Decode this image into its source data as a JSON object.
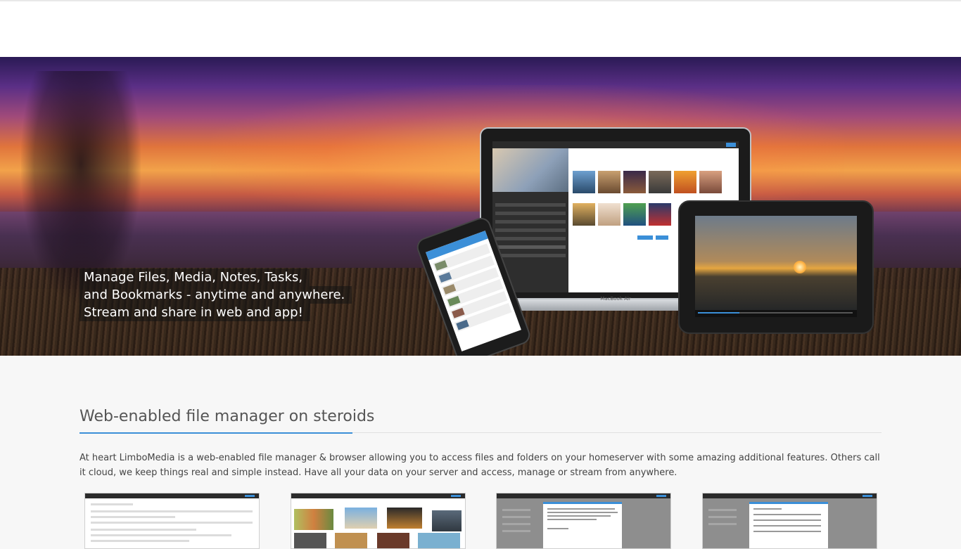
{
  "hero": {
    "tagline": [
      "Manage Files, Media, Notes, Tasks,",
      "and Bookmarks - anytime and anywhere.",
      "Stream and share in web and app!"
    ],
    "laptop_brand": "MacBook Air"
  },
  "section": {
    "title": "Web-enabled file manager on steroids",
    "intro": "At heart LimboMedia is a web-enabled file manager & browser allowing you to access files and folders on your homeserver with some amazing additional features. Others call it cloud, we keep things real and simple instead. Have all your data on your server and access, manage or stream from anywhere."
  },
  "screenshots": [
    {
      "name": "file-list-screenshot"
    },
    {
      "name": "photo-gallery-screenshot"
    },
    {
      "name": "notes-dialog-screenshot"
    },
    {
      "name": "share-dialog-screenshot"
    }
  ],
  "colors": {
    "accent": "#3b8fd8",
    "tagline_bg": "rgba(20,20,20,0.55)"
  },
  "tablet_playback_progress": 0.27
}
